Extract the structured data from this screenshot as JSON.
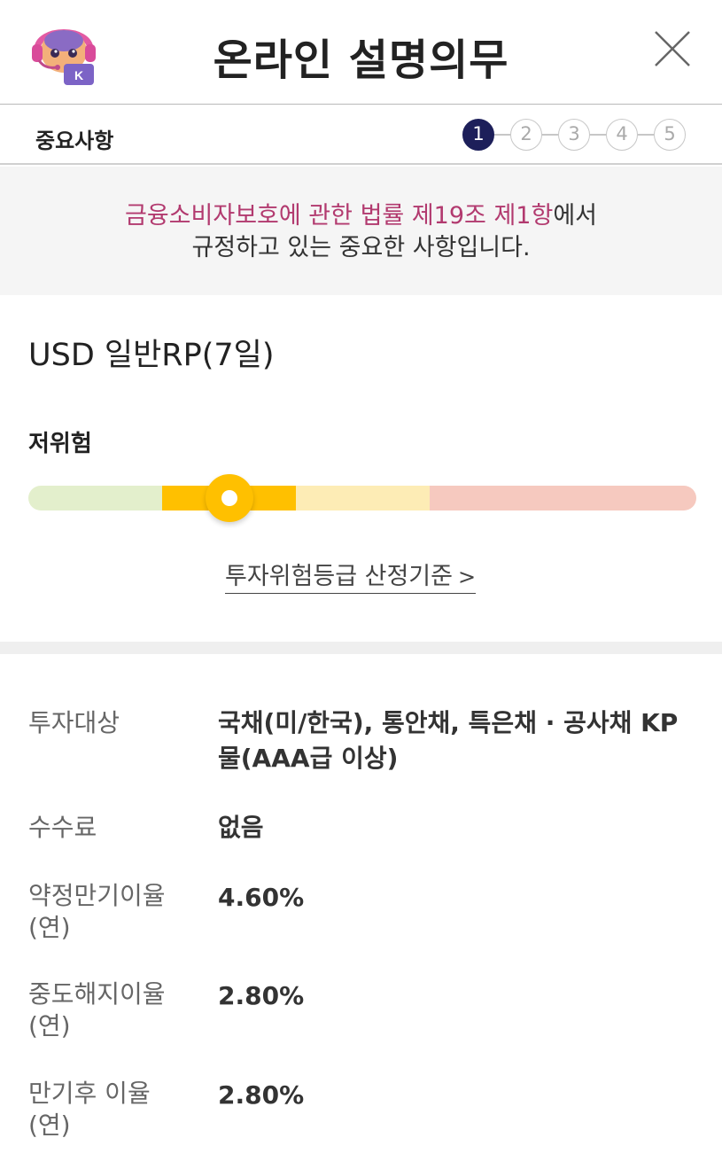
{
  "header": {
    "title": "온라인 설명의무",
    "avatar_icon": "headset-robot-icon",
    "close_icon": "close-icon"
  },
  "stepbar": {
    "label": "중요사항",
    "current_step": 1,
    "steps": [
      "1",
      "2",
      "3",
      "4",
      "5"
    ]
  },
  "notice": {
    "highlight": "금융소비자보호에 관한 법률 제19조 제1항",
    "suffix": "에서",
    "line2": "규정하고 있는 중요한 사항입니다.",
    "highlight_color": "#b23a6f"
  },
  "product": {
    "name": "USD 일반RP(7일)"
  },
  "risk": {
    "label": "저위험",
    "level_index": 1,
    "segment_colors": [
      "#e3efcc",
      "#ffc000",
      "#fdecb5",
      "#f6c9bf"
    ],
    "criteria_link": "투자위험등급 산정기준"
  },
  "info": [
    {
      "key": "투자대상",
      "value_lines": [
        "국채(미/한국), 통안채, 특은채 · 공사채 KP",
        "물(AAA급 이상)"
      ]
    },
    {
      "key": "수수료",
      "value_lines": [
        "없음"
      ]
    },
    {
      "key_lines": [
        "약정만기이율",
        "(연)"
      ],
      "value_lines": [
        "4.60%"
      ]
    },
    {
      "key_lines": [
        "중도해지이율",
        "(연)"
      ],
      "value_lines": [
        "2.80%"
      ]
    },
    {
      "key_lines": [
        "만기후 이율",
        "(연)"
      ],
      "value_lines": [
        "2.80%"
      ]
    }
  ],
  "colors": {
    "step_active": "#1d1f5a",
    "knob": "#ffc000"
  }
}
